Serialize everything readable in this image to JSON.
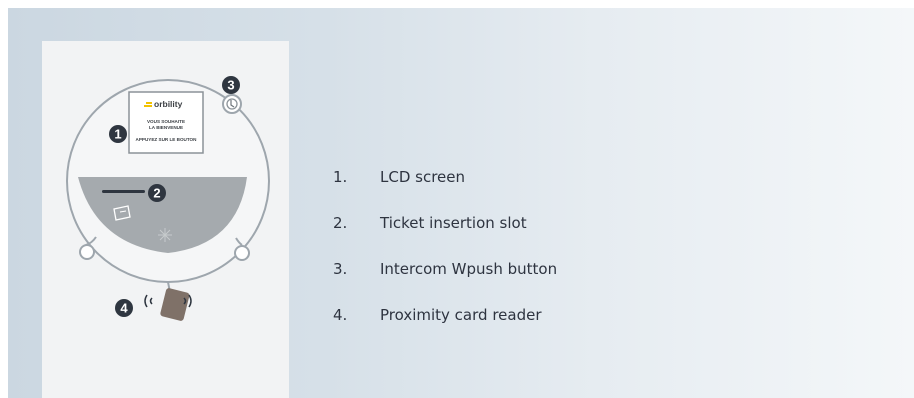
{
  "colors": {
    "background_gradient_start": "#cbd7e1",
    "background_gradient_end": "#f4f7f9",
    "card": "#f2f3f4",
    "device_outline": "#9ea6ad",
    "slot_plate": "#a5aaae",
    "callout_badge": "#2f3640",
    "logo_accent": "#f2c200",
    "text": "#2e3440"
  },
  "device": {
    "lcd": {
      "logo_text": "orbility",
      "line1": "VOUS SOUHAITE",
      "line2": "LA BIENVENUE",
      "line3": "APPUYEZ SUR LE BOUTON"
    },
    "callouts": [
      "1",
      "2",
      "3",
      "4"
    ]
  },
  "legend": [
    {
      "number": "1.",
      "label": "LCD screen"
    },
    {
      "number": "2.",
      "label": "Ticket insertion slot"
    },
    {
      "number": "3.",
      "label": "Intercom Wpush button"
    },
    {
      "number": "4.",
      "label": "Proximity card reader"
    }
  ]
}
